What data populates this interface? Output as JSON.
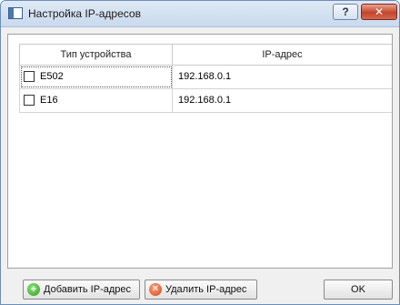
{
  "window": {
    "title": "Настройка IP-адресов",
    "help_label": "?",
    "close_label": "✕"
  },
  "table": {
    "columns": [
      "Тип устройства",
      "IP-адрес"
    ],
    "rows": [
      {
        "device": "E502",
        "ip": "192.168.0.1",
        "checked": false
      },
      {
        "device": "E16",
        "ip": "192.168.0.1",
        "checked": false
      }
    ]
  },
  "footer": {
    "add_label": "Добавить IP-адрес",
    "remove_label": "Удалить IP-адрес",
    "ok_label": "OK"
  },
  "icons": {
    "add": "plus-circle-icon",
    "remove": "x-circle-icon",
    "app": "window-icon"
  },
  "colors": {
    "add_icon": "#2e9e1e",
    "remove_icon": "#d44a1a",
    "close_button": "#c4452b"
  }
}
